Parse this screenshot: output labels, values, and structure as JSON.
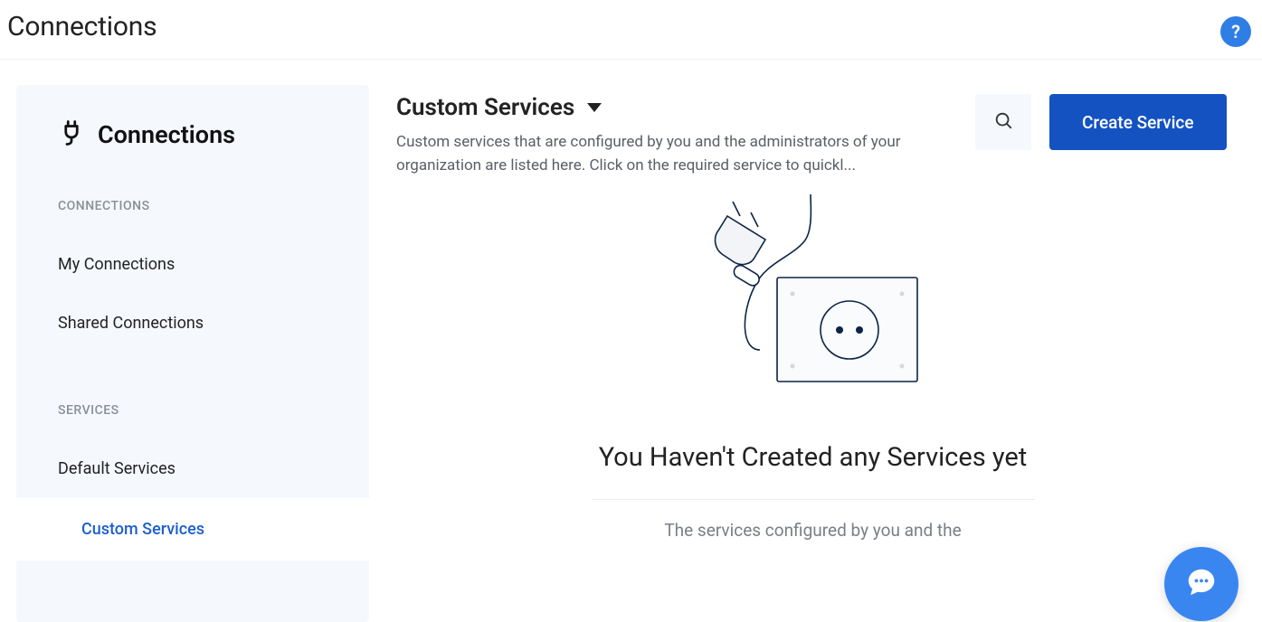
{
  "page": {
    "title": "Connections"
  },
  "sidebar": {
    "title": "Connections",
    "sections": {
      "connections_label": "CONNECTIONS",
      "services_label": "SERVICES"
    },
    "items": {
      "my_connections": "My Connections",
      "shared_connections": "Shared Connections",
      "default_services": "Default Services",
      "custom_services": "Custom Services"
    }
  },
  "main": {
    "heading": "Custom Services",
    "description": "Custom services that are configured by you and the administrators of your organization are listed here. Click on the required service to quickl...",
    "create_button": "Create Service"
  },
  "empty_state": {
    "title": "You Haven't Created any Services yet",
    "subtitle": "The services configured by you and the"
  },
  "help_label": "?",
  "icons": {
    "plug": "plug-icon",
    "search": "search-icon",
    "caret": "caret-down-icon",
    "chat": "chat-icon",
    "help": "help-icon"
  }
}
